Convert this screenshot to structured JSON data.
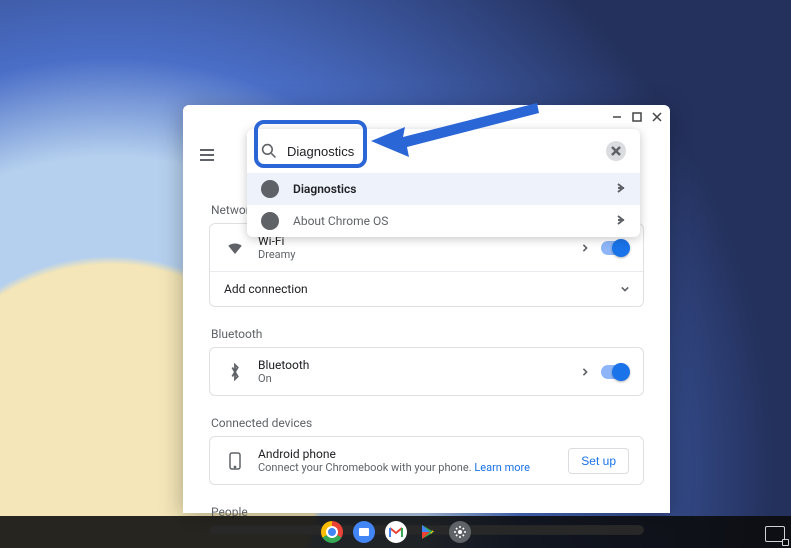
{
  "search": {
    "value": "Diagnostics",
    "results": [
      {
        "label": "Diagnostics",
        "selected": true
      },
      {
        "label": "About Chrome OS",
        "selected": false
      }
    ]
  },
  "sections": {
    "network": {
      "title": "Network",
      "wifi": {
        "label": "Wi-Fi",
        "sub": "Dreamy"
      },
      "add": "Add connection"
    },
    "bluetooth": {
      "title": "Bluetooth",
      "item": {
        "label": "Bluetooth",
        "sub": "On"
      }
    },
    "connected": {
      "title": "Connected devices",
      "item": {
        "label": "Android phone",
        "sub_pre": "Connect your Chromebook with your phone. ",
        "learn": "Learn more"
      },
      "setup": "Set up"
    },
    "people": {
      "title": "People"
    }
  }
}
